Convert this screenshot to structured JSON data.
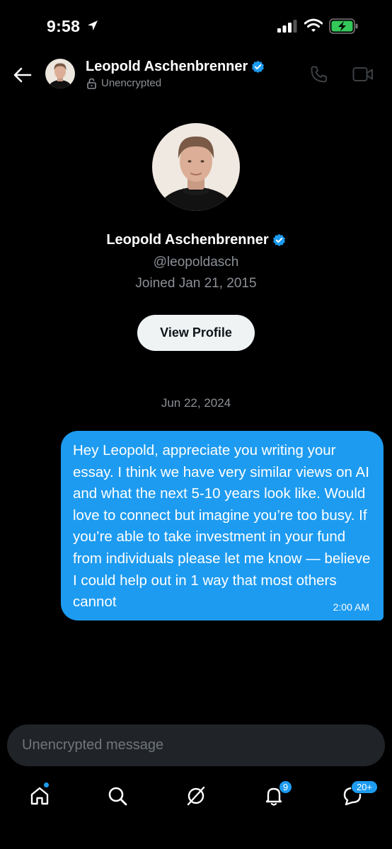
{
  "status_bar": {
    "time": "9:58"
  },
  "header": {
    "name": "Leopold Aschenbrenner",
    "encryption_label": "Unencrypted",
    "verified": true
  },
  "profile": {
    "name": "Leopold Aschenbrenner",
    "handle": "@leopoldasch",
    "joined": "Joined Jan 21, 2015",
    "view_profile_label": "View Profile"
  },
  "conversation": {
    "date_separator": "Jun 22, 2024",
    "messages": [
      {
        "text": "Hey Leopold, appreciate you writing your essay. I think we have very similar views on AI and what the next 5-10 years look like. Would love to connect but imagine you’re too busy. If you’re able to take investment in your fund from individuals please let me know — believe I could help out in 1 way that most others cannot",
        "time": "2:00 AM",
        "sender": "me"
      }
    ]
  },
  "composer": {
    "placeholder": "Unencrypted message"
  },
  "tabbar": {
    "notifications_badge": "9",
    "messages_badge": "20+"
  },
  "colors": {
    "accent": "#1d9bf0",
    "background": "#000000",
    "secondary_text": "#8b9096",
    "composer_bg": "#202327"
  }
}
